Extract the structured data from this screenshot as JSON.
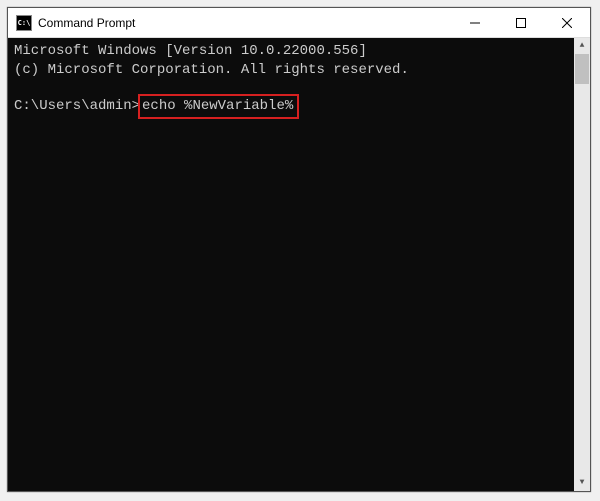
{
  "window": {
    "title": "Command Prompt",
    "icon_text": "C:\\"
  },
  "terminal": {
    "line1": "Microsoft Windows [Version 10.0.22000.556]",
    "line2": "(c) Microsoft Corporation. All rights reserved.",
    "prompt": "C:\\Users\\admin>",
    "command": "echo %NewVariable%"
  }
}
